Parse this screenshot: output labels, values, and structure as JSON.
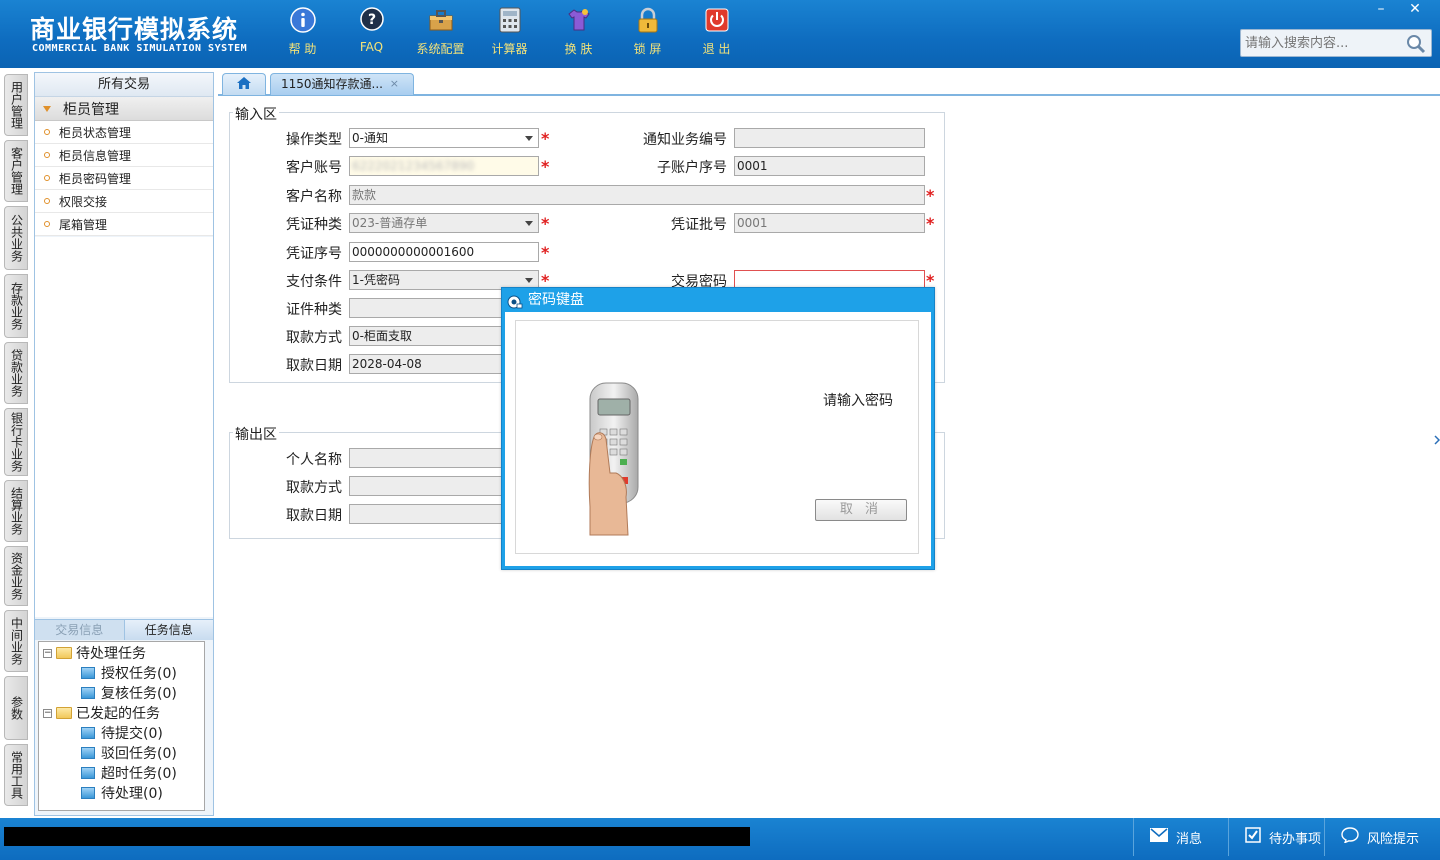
{
  "app": {
    "title": "商业银行模拟系统",
    "subtitle": "COMMERCIAL BANK SIMULATION SYSTEM"
  },
  "toolbar": [
    {
      "label": "帮 助",
      "icon": "help-icon"
    },
    {
      "label": "FAQ",
      "icon": "faq-icon"
    },
    {
      "label": "系统配置",
      "icon": "toolbox-icon"
    },
    {
      "label": "计算器",
      "icon": "calculator-icon"
    },
    {
      "label": "换 肤",
      "icon": "skin-shirt-icon"
    },
    {
      "label": "锁 屏",
      "icon": "lock-icon"
    },
    {
      "label": "退 出",
      "icon": "power-icon"
    }
  ],
  "window_controls": {
    "minimize": "–",
    "close": "✕"
  },
  "search": {
    "placeholder": "请输入搜索内容..."
  },
  "vertical_tabs": [
    "用户管理",
    "客户管理",
    "公共业务",
    "存款业务",
    "贷款业务",
    "银行卡业务",
    "结算业务",
    "资金业务",
    "中间业务",
    "参数",
    "常用工具"
  ],
  "left_panel": {
    "header": "所有交易",
    "group": "柜员管理",
    "items": [
      "柜员状态管理",
      "柜员信息管理",
      "柜员密码管理",
      "权限交接",
      "尾箱管理"
    ],
    "info_tabs": [
      "交易信息",
      "任务信息"
    ],
    "tree": {
      "pending": "待处理任务",
      "pending_children": [
        "授权任务(0)",
        "复核任务(0)"
      ],
      "initiated": "已发起的任务",
      "initiated_children": [
        "待提交(0)",
        "驳回任务(0)",
        "超时任务(0)",
        "待处理(0)"
      ]
    }
  },
  "tabs": {
    "doc_tab": "1150通知存款通...",
    "close": "×"
  },
  "input_section": {
    "title": "输入区",
    "fields": {
      "op_type": {
        "label": "操作类型",
        "value": "0-通知"
      },
      "notice_no": {
        "label": "通知业务编号",
        "value": ""
      },
      "account": {
        "label": "客户账号",
        "value": "6222021234567890"
      },
      "sub_account": {
        "label": "子账户序号",
        "value": "0001"
      },
      "customer_name": {
        "label": "客户名称",
        "value": "款款"
      },
      "voucher_type": {
        "label": "凭证种类",
        "value": "023-普通存单"
      },
      "voucher_batch": {
        "label": "凭证批号",
        "value": "0001"
      },
      "voucher_no": {
        "label": "凭证序号",
        "value": "0000000000001600"
      },
      "pay_condition": {
        "label": "支付条件",
        "value": "1-凭密码"
      },
      "trade_pwd": {
        "label": "交易密码",
        "value": ""
      },
      "id_type": {
        "label": "证件种类",
        "value": ""
      },
      "withdraw_mode": {
        "label": "取款方式",
        "value": "0-柜面支取"
      },
      "withdraw_date": {
        "label": "取款日期",
        "value": "2028-04-08"
      }
    }
  },
  "output_section": {
    "title": "输出区",
    "fields": {
      "personal_name": {
        "label": "个人名称",
        "value": ""
      },
      "withdraw_mode": {
        "label": "取款方式",
        "value": ""
      },
      "withdraw_date": {
        "label": "取款日期",
        "value": ""
      }
    }
  },
  "dialog": {
    "title": "密码键盘",
    "message": "请输入密码",
    "cancel": "取 消"
  },
  "statusbar": [
    {
      "label": "消息",
      "icon": "mail-icon"
    },
    {
      "label": "待办事项",
      "icon": "checkbox-icon"
    },
    {
      "label": "风险提示",
      "icon": "chat-bubble-icon"
    }
  ],
  "colors": {
    "header": "#0e6cbf",
    "accent_yellow": "#f2e27a",
    "required": "#e02020",
    "dialog": "#1ea1e8"
  }
}
